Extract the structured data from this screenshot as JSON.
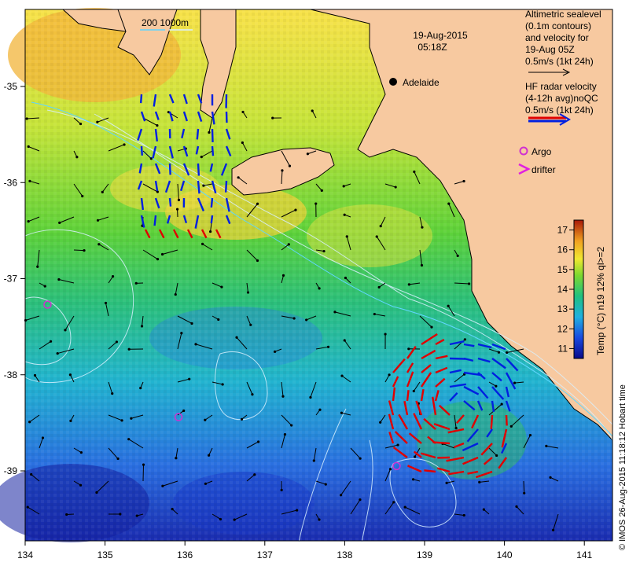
{
  "title": {
    "date": "19-Aug-2015",
    "time": "05:18Z"
  },
  "scale_label": "200  1000m",
  "place_label": "Adelaide",
  "legend": {
    "altimetry": [
      "Altimetric sealevel",
      "(0.1m contours)",
      "and velocity for",
      "19-Aug 05Z",
      "0.5m/s (1kt 24h)"
    ],
    "hf_radar": [
      "HF radar velocity",
      "(4-12h avg)noQC",
      "0.5m/s (1kt 24h)"
    ],
    "argo": "Argo",
    "drifter": "drifter"
  },
  "colorbar": {
    "label": "Temp (°C) n19 12% ql>=2",
    "ticks": [
      "11",
      "12",
      "13",
      "14",
      "15",
      "16",
      "17"
    ]
  },
  "credit": "© IMOS 26-Aug-2015 11:18:12 Hobart time",
  "axes": {
    "x_ticks": [
      "134",
      "135",
      "136",
      "137",
      "138",
      "139",
      "140",
      "141"
    ],
    "y_ticks": [
      "-35",
      "-36",
      "-37",
      "-38",
      "-39"
    ]
  },
  "colors": {
    "land": "#f7c9a0",
    "hf_blue": "#0020e0",
    "hf_red": "#e00000",
    "argo": "#d030d0",
    "drifter": "#e020e0"
  },
  "argo_floats": [
    {
      "lon": 134.28,
      "lat": -37.27
    },
    {
      "lon": 135.92,
      "lat": -38.44
    },
    {
      "lon": 138.65,
      "lat": -38.95
    }
  ]
}
